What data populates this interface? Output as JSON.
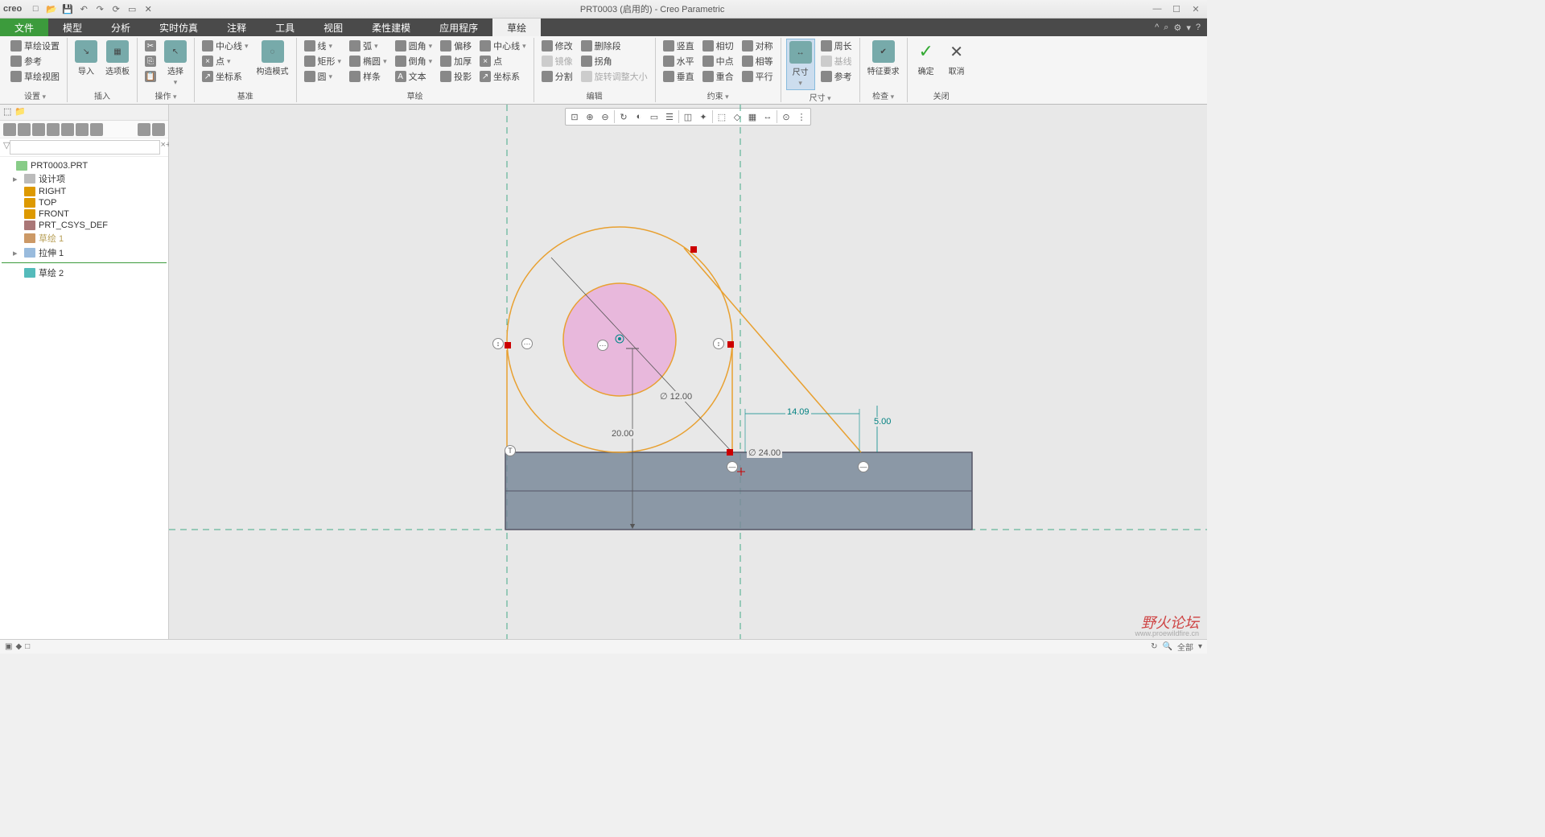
{
  "app": {
    "name": "creo",
    "title": "PRT0003 (启用的) - Creo Parametric"
  },
  "tabs": {
    "file": "文件",
    "model": "模型",
    "analysis": "分析",
    "realtime": "实时仿真",
    "annotate": "注释",
    "tool": "工具",
    "view": "视图",
    "flex": "柔性建模",
    "app": "应用程序",
    "sketch": "草绘"
  },
  "groups": {
    "setup": {
      "sketchSetup": "草绘设置",
      "ref": "参考",
      "sketchView": "草绘视图",
      "label": "设置"
    },
    "insert": {
      "import": "导入",
      "palette": "选项板",
      "label": "插入"
    },
    "ops": {
      "cut": "",
      "copy": "",
      "paste": "",
      "select": "选择",
      "label": "操作"
    },
    "datum": {
      "centerline": "中心线",
      "point": "点",
      "csys": "坐标系",
      "construct": "构造模式",
      "label": "基准"
    },
    "sketch": {
      "line": "线",
      "rect": "矩形",
      "circle": "圆",
      "arc": "弧",
      "ellipse": "椭圆",
      "spline": "样条",
      "fillet": "圆角",
      "chamfer": "倒角",
      "text": "文本",
      "offset": "偏移",
      "thicken": "加厚",
      "proj": "投影",
      "centerline2": "中心线",
      "point2": "点",
      "csys2": "坐标系",
      "label": "草绘"
    },
    "edit": {
      "modify": "修改",
      "mirror": "镜像",
      "divide": "分割",
      "delSeg": "删除段",
      "corner": "拐角",
      "rotResize": "旋转调整大小",
      "label": "编辑"
    },
    "constrain": {
      "vert": "竖直",
      "horiz": "水平",
      "perp": "垂直",
      "tangent": "相切",
      "midpt": "中点",
      "coinc": "重合",
      "sym": "对称",
      "equal": "相等",
      "parallel": "平行",
      "label": "约束"
    },
    "dim": {
      "dimension": "尺寸",
      "perimeter": "周长",
      "baseline": "基线",
      "ref": "参考",
      "label": "尺寸"
    },
    "inspect": {
      "featReq": "特征要求",
      "label": "检查"
    },
    "close": {
      "ok": "确定",
      "cancel": "取消",
      "label": "关闭"
    }
  },
  "tree": {
    "root": "PRT0003.PRT",
    "items": [
      "设计项",
      "RIGHT",
      "TOP",
      "FRONT",
      "PRT_CSYS_DEF",
      "草绘 1",
      "拉伸 1"
    ],
    "active": "草绘 2"
  },
  "dims": {
    "d12": "∅ 12.00",
    "d20": "20.00",
    "d24": "∅ 24.00",
    "d14": "14.09",
    "d5": "5.00"
  },
  "status": {
    "filter": "全部"
  },
  "watermark": {
    "main": "野火论坛",
    "sub": "www.proewildfire.cn"
  }
}
